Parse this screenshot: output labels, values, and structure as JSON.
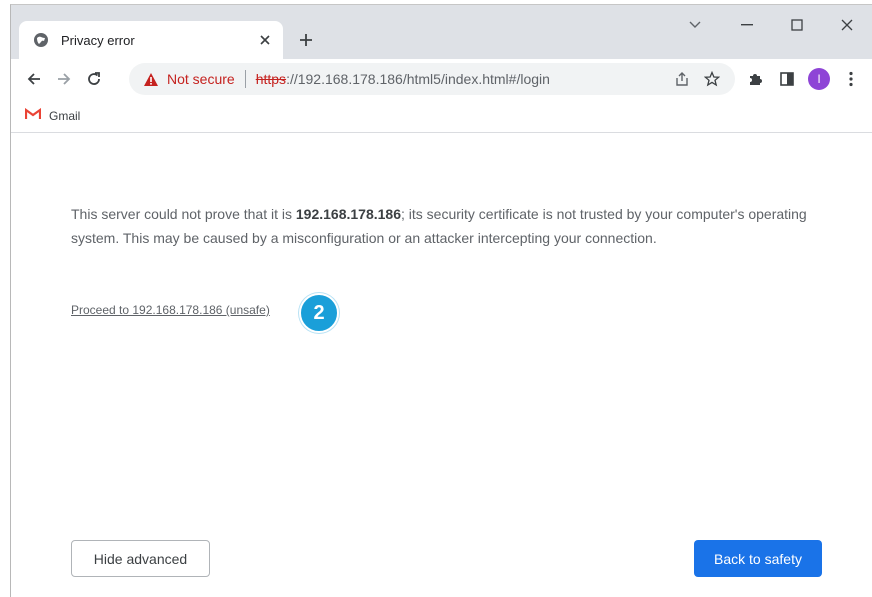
{
  "tab": {
    "title": "Privacy error",
    "favicon": "globe-warning-icon"
  },
  "window_controls": [
    "tab-search",
    "minimize",
    "maximize",
    "close"
  ],
  "toolbar": {
    "security_label": "Not secure",
    "url_scheme": "https",
    "url_rest": "://192.168.178.186/html5/index.html#/login",
    "icons": [
      "back-icon",
      "forward-icon",
      "reload-icon",
      "share-icon",
      "star-icon",
      "extensions-icon",
      "side-panel-icon"
    ],
    "profile_initial": "I",
    "profile_color": "#8e44d6"
  },
  "bookmarks": [
    {
      "label": "Gmail",
      "icon": "gmail-icon"
    }
  ],
  "content": {
    "explain_pre": "This server could not prove that it is ",
    "explain_host": "192.168.178.186",
    "explain_post": "; its security certificate is not trusted by your computer's operating system. This may be caused by a misconfiguration or an attacker intercepting your connection.",
    "proceed_link": "Proceed to 192.168.178.186 (unsafe)",
    "step_number": "2",
    "hide_advanced": "Hide advanced",
    "back_to_safety": "Back to safety"
  },
  "colors": {
    "accent": "#1a73e8",
    "warning": "#c5221f",
    "step_badge": "#1a9fd9"
  }
}
